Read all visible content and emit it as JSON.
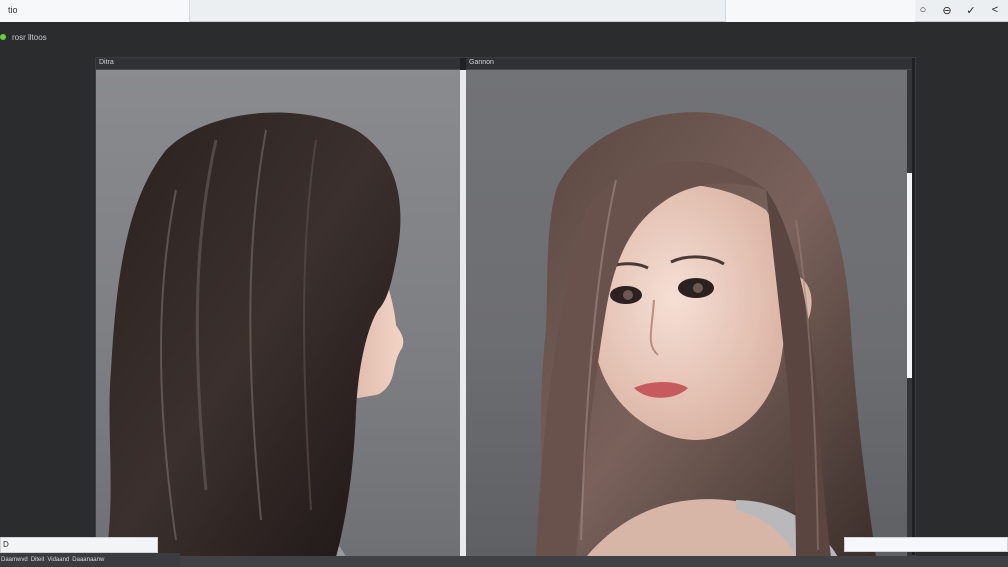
{
  "window": {
    "tabs": [
      {
        "label": "tio"
      },
      {
        "label": ""
      }
    ],
    "actions": [
      {
        "name": "circle-icon",
        "glyph": "○"
      },
      {
        "name": "minus-circle-icon",
        "glyph": "⊖"
      },
      {
        "name": "check-icon",
        "glyph": "✓"
      },
      {
        "name": "back-icon",
        "glyph": "<"
      }
    ]
  },
  "toolbar": {
    "label": "rosr lltoos"
  },
  "compare": {
    "left_pane": {
      "title": "Ditra"
    },
    "right_pane": {
      "title": "Gannon"
    }
  },
  "bottom": {
    "left_label": "D",
    "strip_items": [
      "Daamwvd",
      "Diteit",
      "Vidaand",
      "Daaanaanw"
    ],
    "right_label": ""
  },
  "colors": {
    "accent": "#6ad03a",
    "panel_bg": "#1f2022",
    "window_bg": "#2b2c2e"
  }
}
